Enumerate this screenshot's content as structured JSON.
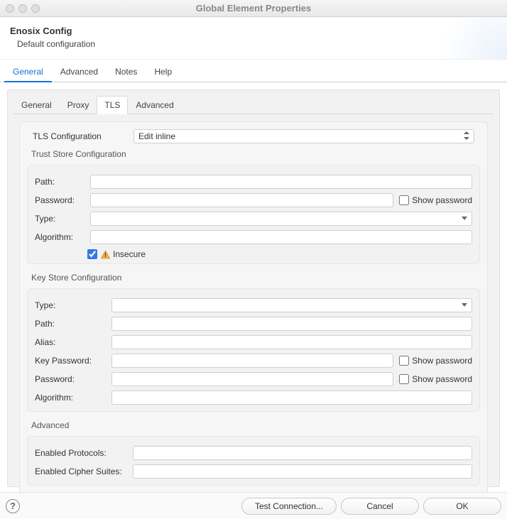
{
  "window": {
    "title": "Global Element Properties"
  },
  "header": {
    "title": "Enosix Config",
    "subtitle": "Default configuration"
  },
  "outerTabs": {
    "general": "General",
    "advanced": "Advanced",
    "notes": "Notes",
    "help": "Help"
  },
  "innerTabs": {
    "general": "General",
    "proxy": "Proxy",
    "tls": "TLS",
    "advanced": "Advanced"
  },
  "tlsConfig": {
    "label": "TLS Configuration",
    "value": "Edit inline"
  },
  "trustStore": {
    "legend": "Trust Store Configuration",
    "pathLabel": "Path:",
    "pathValue": "",
    "passwordLabel": "Password:",
    "passwordValue": "",
    "showPasswordLabel": "Show password",
    "typeLabel": "Type:",
    "typeValue": "",
    "algorithmLabel": "Algorithm:",
    "algorithmValue": "",
    "insecureLabel": "Insecure",
    "insecureChecked": true
  },
  "keyStore": {
    "legend": "Key Store Configuration",
    "typeLabel": "Type:",
    "typeValue": "",
    "pathLabel": "Path:",
    "pathValue": "",
    "aliasLabel": "Alias:",
    "aliasValue": "",
    "keyPasswordLabel": "Key Password:",
    "keyPasswordValue": "",
    "passwordLabel": "Password:",
    "passwordValue": "",
    "algorithmLabel": "Algorithm:",
    "algorithmValue": "",
    "showPasswordLabel": "Show password"
  },
  "advanced": {
    "legend": "Advanced",
    "enabledProtocolsLabel": "Enabled Protocols:",
    "enabledProtocolsValue": "",
    "enabledCipherSuitesLabel": "Enabled Cipher Suites:",
    "enabledCipherSuitesValue": ""
  },
  "buttons": {
    "testConnection": "Test Connection...",
    "cancel": "Cancel",
    "ok": "OK"
  }
}
